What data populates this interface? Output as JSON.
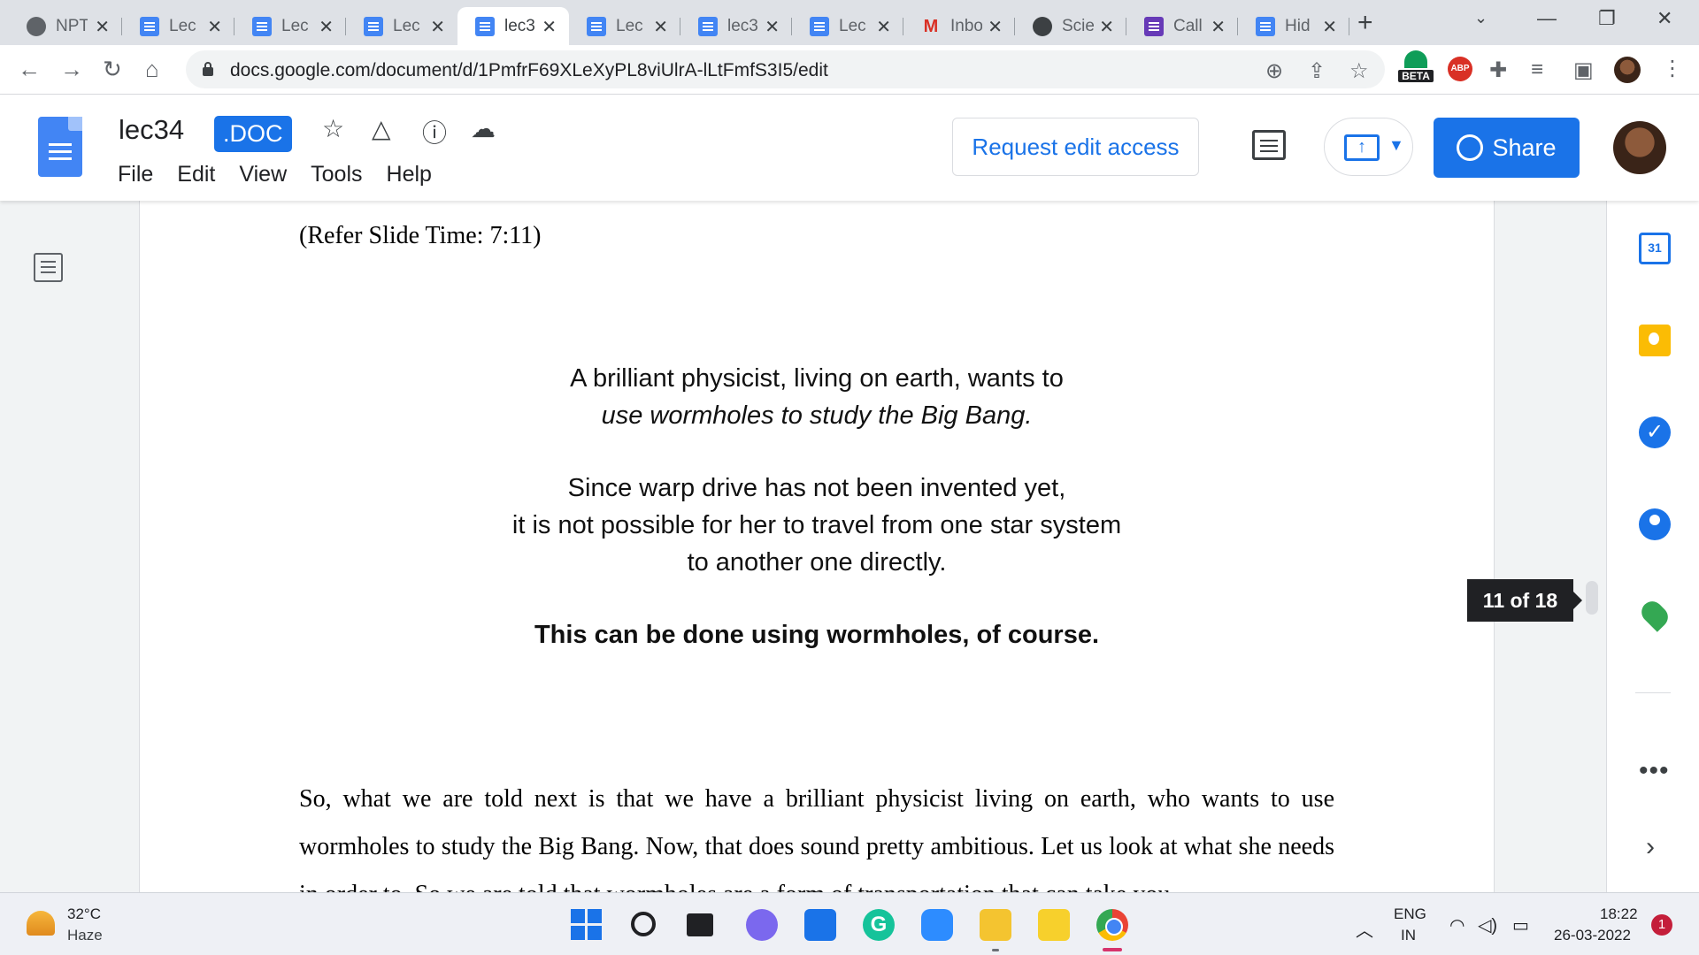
{
  "browser": {
    "tabs": [
      {
        "title": "NPTEL",
        "icon": "globe-icon",
        "active": false
      },
      {
        "title": "Lec",
        "icon": "docs-icon",
        "active": false
      },
      {
        "title": "Lec",
        "icon": "docs-icon",
        "active": false
      },
      {
        "title": "Lec",
        "icon": "docs-icon",
        "active": false
      },
      {
        "title": "lec3",
        "icon": "docs-icon",
        "active": true
      },
      {
        "title": "Lec",
        "icon": "docs-icon",
        "active": false
      },
      {
        "title": "lec3",
        "icon": "docs-icon",
        "active": false
      },
      {
        "title": "Lec",
        "icon": "docs-icon",
        "active": false
      },
      {
        "title": "Inbo",
        "icon": "gmail-icon",
        "active": false
      },
      {
        "title": "Scie",
        "icon": "science-icon",
        "active": false
      },
      {
        "title": "Call",
        "icon": "forms-icon",
        "active": false
      },
      {
        "title": "Hid",
        "icon": "docs-icon",
        "active": false
      }
    ],
    "url": "docs.google.com/document/d/1PmfrF69XLeXyPL8viUlrA-lLtFmfS3I5/edit",
    "extension_badge": "BETA",
    "abp_label": "ABP"
  },
  "docs": {
    "title": "lec34",
    "badge": ".DOC",
    "menu": [
      "File",
      "Edit",
      "View",
      "Tools",
      "Help"
    ],
    "request_edit": "Request edit access",
    "share": "Share"
  },
  "document": {
    "refer_slide": "(Refer Slide Time: 7:11)",
    "slide_lines": {
      "l1": "A brilliant physicist, living on earth, wants to",
      "l2": "use wormholes to study the Big Bang.",
      "l3": "Since warp drive has not been invented yet,",
      "l4": "it is not possible for her to travel from one star system",
      "l5": "to another one directly.",
      "l6": "This can be done using wormholes, of course."
    },
    "paragraph": "So, what we are told next is that we have a brilliant physicist living on earth, who wants to use wormholes to study the Big Bang. Now, that does sound pretty ambitious. Let us look at what she needs in order to. So we are told that wormholes are a form of transportation that can take you"
  },
  "page_indicator": "11 of 18",
  "side_panel": {
    "calendar_day": "31",
    "more": "•••",
    "expand": "›"
  },
  "taskbar": {
    "temperature": "32°C",
    "condition": "Haze",
    "grammarly": "G",
    "lang1": "ENG",
    "lang2": "IN",
    "time": "18:22",
    "date": "26-03-2022",
    "notifications": "1"
  }
}
